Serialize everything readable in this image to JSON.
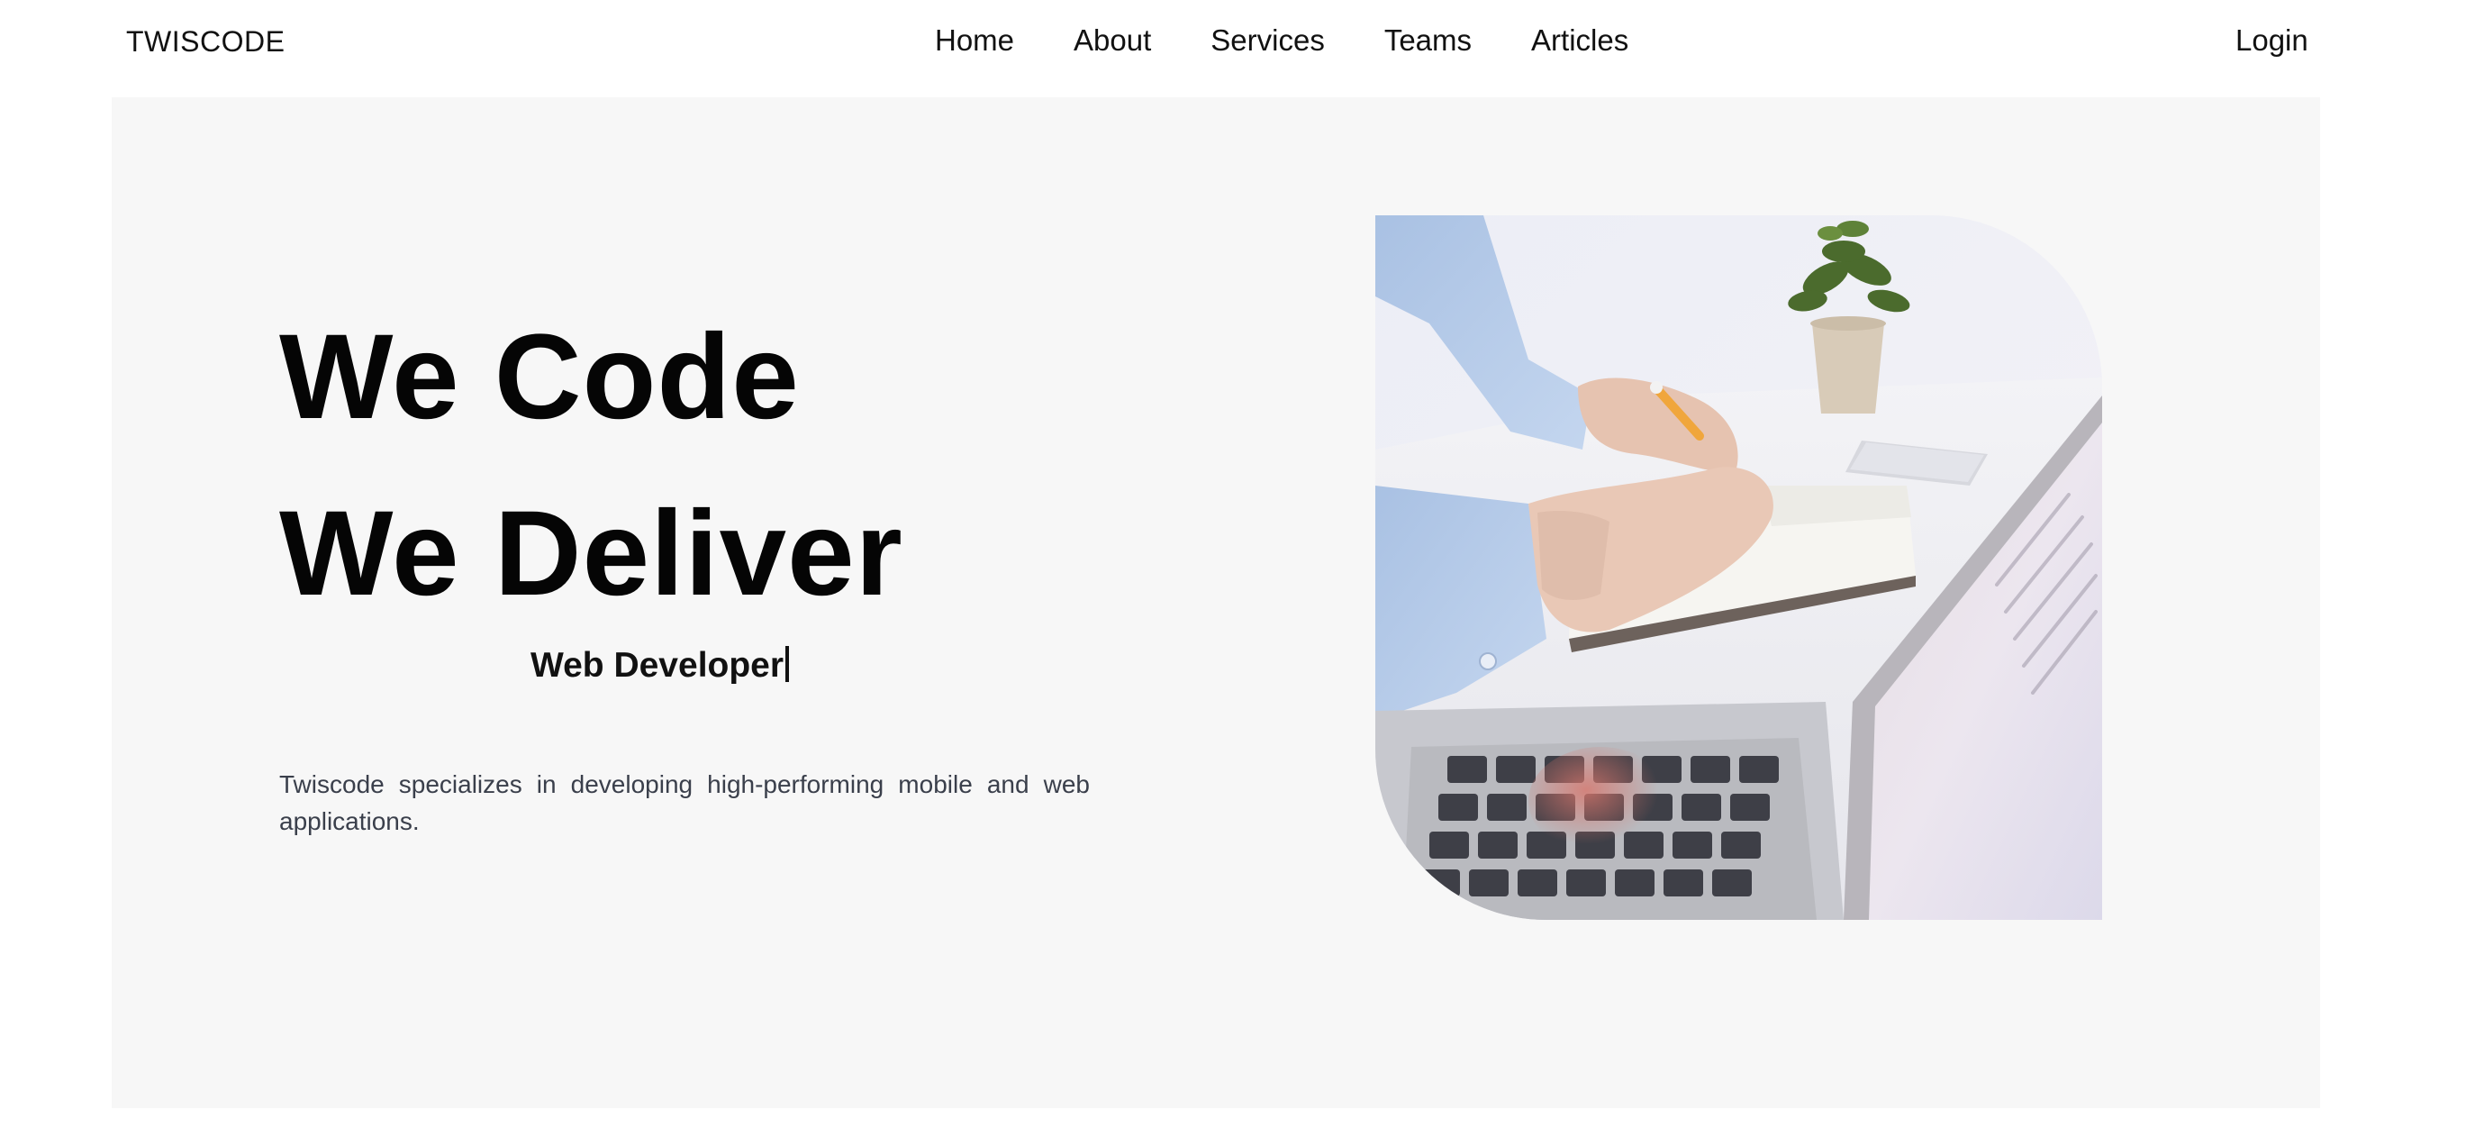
{
  "brand": "TWISCODE",
  "nav": {
    "links": [
      "Home",
      "About",
      "Services",
      "Teams",
      "Articles"
    ],
    "login": "Login"
  },
  "hero": {
    "headline_line1": "We Code",
    "headline_line2": "We Deliver",
    "role": "Web Developer",
    "description": "Twiscode specializes in developing high-performing mobile and web applications.",
    "image_icon": "laptop-desk-photo"
  },
  "colors": {
    "page_background": "#ffffff",
    "hero_background": "#f7f7f7",
    "heading_text": "#050505",
    "body_text": "#3a3f4b"
  }
}
